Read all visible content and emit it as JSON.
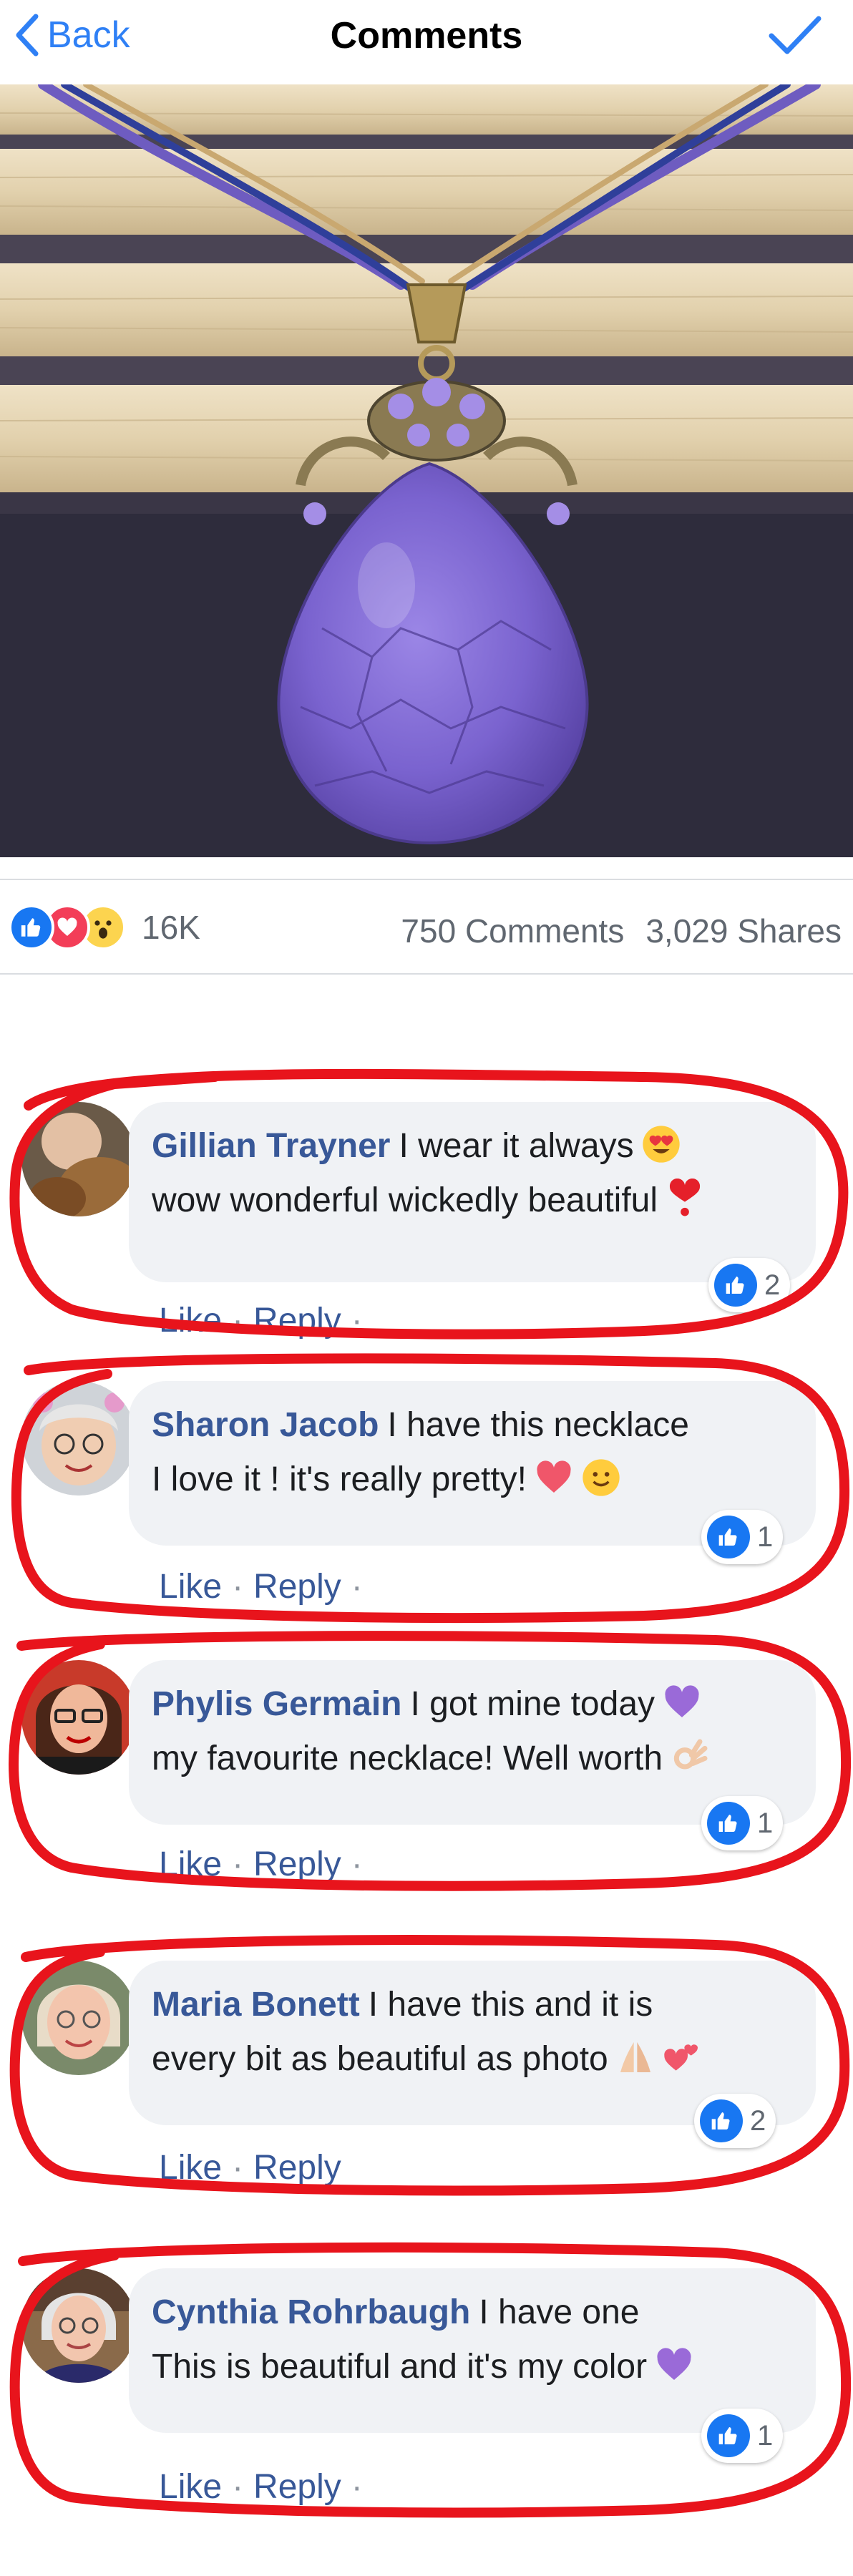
{
  "nav": {
    "back_label": "Back",
    "title": "Comments"
  },
  "post": {
    "reaction_count": "16K",
    "comments_count": "750 Comments",
    "shares_count": "3,029 Shares"
  },
  "comments": [
    {
      "author": "Gillian Trayner",
      "line1": "I wear it always",
      "line2": "wow wonderful wickedly beautiful",
      "likes": "2",
      "like_label": "Like",
      "reply_label": "Reply"
    },
    {
      "author": "Sharon Jacob",
      "line1": "I have this necklace",
      "line2": "I love it ! it's really pretty!",
      "likes": "1",
      "like_label": "Like",
      "reply_label": "Reply"
    },
    {
      "author": "Phylis Germain",
      "line1": "I got mine today",
      "line2": "my favourite necklace! Well worth",
      "likes": "1",
      "like_label": "Like",
      "reply_label": "Reply"
    },
    {
      "author": "Maria Bonett",
      "line1": "I have this and it is",
      "line2": "every bit as beautiful as photo",
      "likes": "2",
      "like_label": "Like",
      "reply_label": "Reply"
    },
    {
      "author": "Cynthia Rohrbaugh",
      "line1": "I have one",
      "line2": "This is beautiful and it's my color",
      "likes": "1",
      "like_label": "Like",
      "reply_label": "Reply"
    }
  ],
  "colors": {
    "accent": "#2f80f5",
    "author": "#385898",
    "like_blue": "#1877f2",
    "annotation_red": "#e8141c"
  },
  "icons": [
    "chevron-left-icon",
    "checkmark-icon",
    "like-reaction-icon",
    "love-reaction-icon",
    "wow-reaction-icon",
    "thumbs-up-icon"
  ]
}
